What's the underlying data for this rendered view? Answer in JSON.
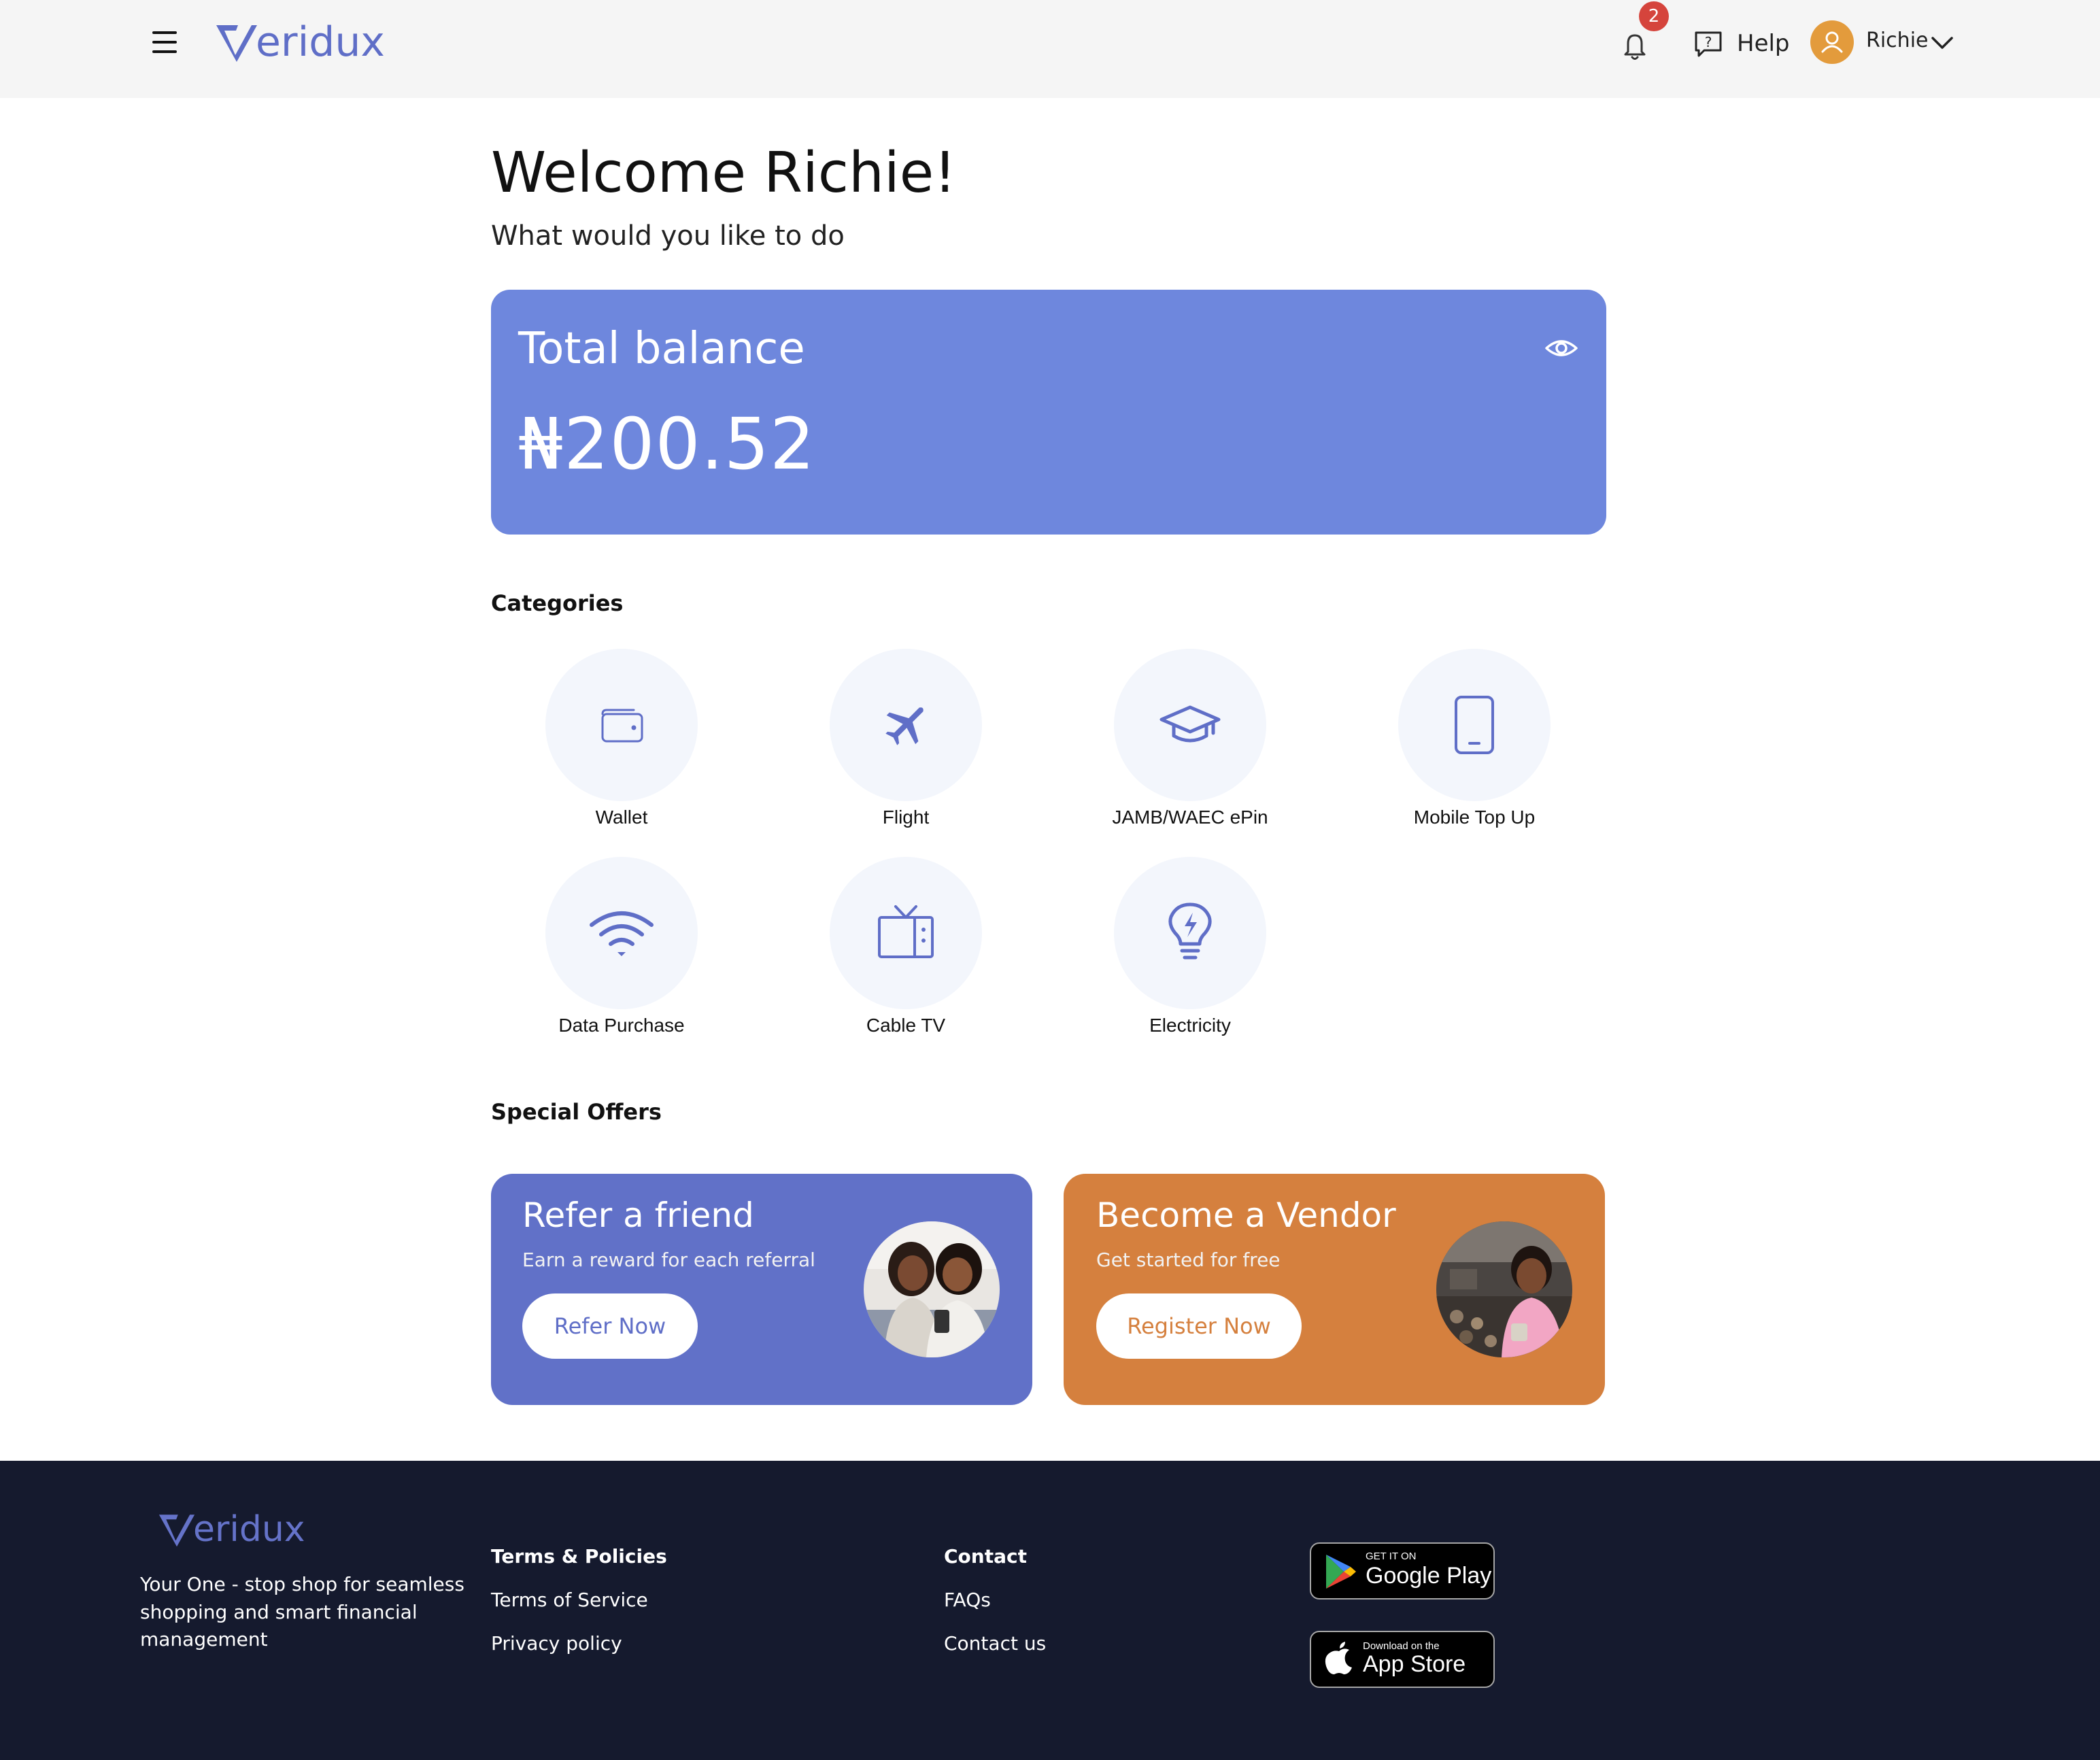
{
  "header": {
    "brand": "eridux",
    "notification_count": "2",
    "help_label": "Help",
    "user_name": "Richie",
    "menu_icon": "hamburger-menu-icon",
    "bell_icon": "bell-icon",
    "help_icon": "help-chat-icon",
    "avatar_icon": "user-avatar-icon",
    "chevron_icon": "chevron-down-icon"
  },
  "welcome": {
    "title": "Welcome Richie!",
    "subtitle": "What would you like to do"
  },
  "balance": {
    "label": "Total balance",
    "amount": "₦200.52",
    "eye_icon": "eye-icon",
    "card_color": "#6e87dd"
  },
  "categories": {
    "title": "Categories",
    "items": [
      {
        "label": "Wallet",
        "icon": "wallet-icon"
      },
      {
        "label": "Flight",
        "icon": "airplane-icon"
      },
      {
        "label": "JAMB/WAEC ePin",
        "icon": "graduation-cap-icon"
      },
      {
        "label": "Mobile Top Up",
        "icon": "mobile-phone-icon"
      },
      {
        "label": "Data Purchase",
        "icon": "wifi-icon"
      },
      {
        "label": "Cable TV",
        "icon": "tv-icon"
      },
      {
        "label": "Electricity",
        "icon": "lightbulb-icon"
      }
    ]
  },
  "offers": {
    "title": "Special Offers",
    "refer": {
      "title": "Refer a friend",
      "subtitle": "Earn a reward for each referral",
      "button": "Refer Now",
      "color": "#6171c8"
    },
    "vendor": {
      "title": "Become a Vendor",
      "subtitle": "Get started for free",
      "button": "Register Now",
      "color": "#d5803e"
    }
  },
  "footer": {
    "brand": "eridux",
    "tagline": "Your One - stop shop for seamless shopping and smart financial management",
    "policies": {
      "heading": "Terms & Policies",
      "links": [
        "Terms of Service",
        "Privacy policy"
      ]
    },
    "contact": {
      "heading": "Contact",
      "links": [
        "FAQs",
        "Contact us"
      ]
    },
    "google_play": {
      "small": "GET IT ON",
      "big": "Google Play"
    },
    "app_store": {
      "small": "Download on the",
      "big": "App Store"
    }
  },
  "colors": {
    "accent": "#5f6ec7",
    "footer_bg": "#151a2e",
    "badge": "#d5443c",
    "avatar": "#e39b3c"
  }
}
